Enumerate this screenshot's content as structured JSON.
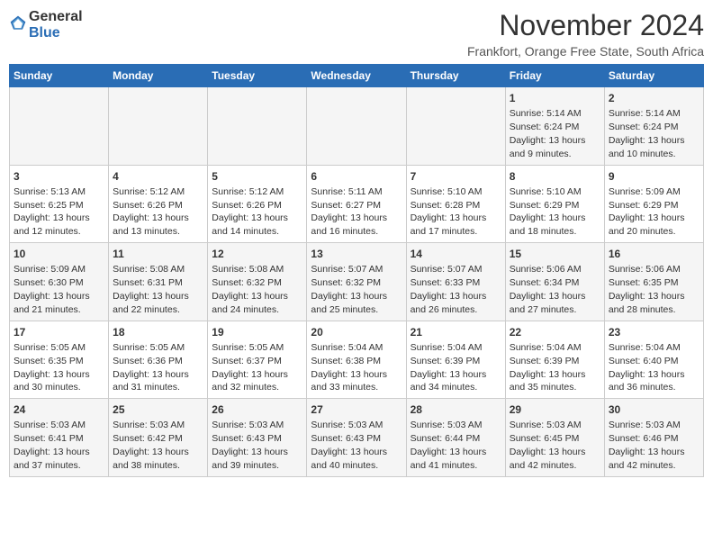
{
  "logo": {
    "general": "General",
    "blue": "Blue"
  },
  "header": {
    "month": "November 2024",
    "location": "Frankfort, Orange Free State, South Africa"
  },
  "weekdays": [
    "Sunday",
    "Monday",
    "Tuesday",
    "Wednesday",
    "Thursday",
    "Friday",
    "Saturday"
  ],
  "weeks": [
    [
      {
        "day": "",
        "info": ""
      },
      {
        "day": "",
        "info": ""
      },
      {
        "day": "",
        "info": ""
      },
      {
        "day": "",
        "info": ""
      },
      {
        "day": "",
        "info": ""
      },
      {
        "day": "1",
        "info": "Sunrise: 5:14 AM\nSunset: 6:24 PM\nDaylight: 13 hours and 9 minutes."
      },
      {
        "day": "2",
        "info": "Sunrise: 5:14 AM\nSunset: 6:24 PM\nDaylight: 13 hours and 10 minutes."
      }
    ],
    [
      {
        "day": "3",
        "info": "Sunrise: 5:13 AM\nSunset: 6:25 PM\nDaylight: 13 hours and 12 minutes."
      },
      {
        "day": "4",
        "info": "Sunrise: 5:12 AM\nSunset: 6:26 PM\nDaylight: 13 hours and 13 minutes."
      },
      {
        "day": "5",
        "info": "Sunrise: 5:12 AM\nSunset: 6:26 PM\nDaylight: 13 hours and 14 minutes."
      },
      {
        "day": "6",
        "info": "Sunrise: 5:11 AM\nSunset: 6:27 PM\nDaylight: 13 hours and 16 minutes."
      },
      {
        "day": "7",
        "info": "Sunrise: 5:10 AM\nSunset: 6:28 PM\nDaylight: 13 hours and 17 minutes."
      },
      {
        "day": "8",
        "info": "Sunrise: 5:10 AM\nSunset: 6:29 PM\nDaylight: 13 hours and 18 minutes."
      },
      {
        "day": "9",
        "info": "Sunrise: 5:09 AM\nSunset: 6:29 PM\nDaylight: 13 hours and 20 minutes."
      }
    ],
    [
      {
        "day": "10",
        "info": "Sunrise: 5:09 AM\nSunset: 6:30 PM\nDaylight: 13 hours and 21 minutes."
      },
      {
        "day": "11",
        "info": "Sunrise: 5:08 AM\nSunset: 6:31 PM\nDaylight: 13 hours and 22 minutes."
      },
      {
        "day": "12",
        "info": "Sunrise: 5:08 AM\nSunset: 6:32 PM\nDaylight: 13 hours and 24 minutes."
      },
      {
        "day": "13",
        "info": "Sunrise: 5:07 AM\nSunset: 6:32 PM\nDaylight: 13 hours and 25 minutes."
      },
      {
        "day": "14",
        "info": "Sunrise: 5:07 AM\nSunset: 6:33 PM\nDaylight: 13 hours and 26 minutes."
      },
      {
        "day": "15",
        "info": "Sunrise: 5:06 AM\nSunset: 6:34 PM\nDaylight: 13 hours and 27 minutes."
      },
      {
        "day": "16",
        "info": "Sunrise: 5:06 AM\nSunset: 6:35 PM\nDaylight: 13 hours and 28 minutes."
      }
    ],
    [
      {
        "day": "17",
        "info": "Sunrise: 5:05 AM\nSunset: 6:35 PM\nDaylight: 13 hours and 30 minutes."
      },
      {
        "day": "18",
        "info": "Sunrise: 5:05 AM\nSunset: 6:36 PM\nDaylight: 13 hours and 31 minutes."
      },
      {
        "day": "19",
        "info": "Sunrise: 5:05 AM\nSunset: 6:37 PM\nDaylight: 13 hours and 32 minutes."
      },
      {
        "day": "20",
        "info": "Sunrise: 5:04 AM\nSunset: 6:38 PM\nDaylight: 13 hours and 33 minutes."
      },
      {
        "day": "21",
        "info": "Sunrise: 5:04 AM\nSunset: 6:39 PM\nDaylight: 13 hours and 34 minutes."
      },
      {
        "day": "22",
        "info": "Sunrise: 5:04 AM\nSunset: 6:39 PM\nDaylight: 13 hours and 35 minutes."
      },
      {
        "day": "23",
        "info": "Sunrise: 5:04 AM\nSunset: 6:40 PM\nDaylight: 13 hours and 36 minutes."
      }
    ],
    [
      {
        "day": "24",
        "info": "Sunrise: 5:03 AM\nSunset: 6:41 PM\nDaylight: 13 hours and 37 minutes."
      },
      {
        "day": "25",
        "info": "Sunrise: 5:03 AM\nSunset: 6:42 PM\nDaylight: 13 hours and 38 minutes."
      },
      {
        "day": "26",
        "info": "Sunrise: 5:03 AM\nSunset: 6:43 PM\nDaylight: 13 hours and 39 minutes."
      },
      {
        "day": "27",
        "info": "Sunrise: 5:03 AM\nSunset: 6:43 PM\nDaylight: 13 hours and 40 minutes."
      },
      {
        "day": "28",
        "info": "Sunrise: 5:03 AM\nSunset: 6:44 PM\nDaylight: 13 hours and 41 minutes."
      },
      {
        "day": "29",
        "info": "Sunrise: 5:03 AM\nSunset: 6:45 PM\nDaylight: 13 hours and 42 minutes."
      },
      {
        "day": "30",
        "info": "Sunrise: 5:03 AM\nSunset: 6:46 PM\nDaylight: 13 hours and 42 minutes."
      }
    ]
  ]
}
